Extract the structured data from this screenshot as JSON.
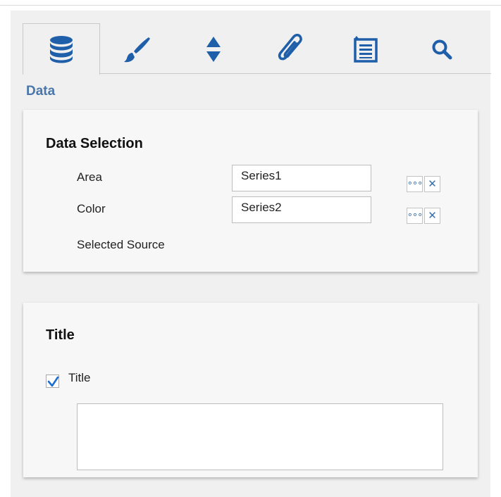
{
  "tabs": [
    {
      "icon": "database-icon",
      "active": true
    },
    {
      "icon": "paintbrush-icon",
      "active": false
    },
    {
      "icon": "sort-arrows-icon",
      "active": false
    },
    {
      "icon": "paperclip-icon",
      "active": false
    },
    {
      "icon": "list-icon",
      "active": false
    },
    {
      "icon": "search-icon",
      "active": false
    }
  ],
  "section_label": "Data",
  "data_selection": {
    "title": "Data Selection",
    "rows": [
      {
        "label": "Area",
        "value": "Series1"
      },
      {
        "label": "Color",
        "value": "Series2"
      }
    ],
    "selected_source_label": "Selected Source"
  },
  "title_section": {
    "heading": "Title",
    "checkbox_label": "Title",
    "checked": true,
    "text_value": ""
  },
  "colors": {
    "accent": "#4a77aa",
    "icon_blue": "#1f5faa"
  }
}
